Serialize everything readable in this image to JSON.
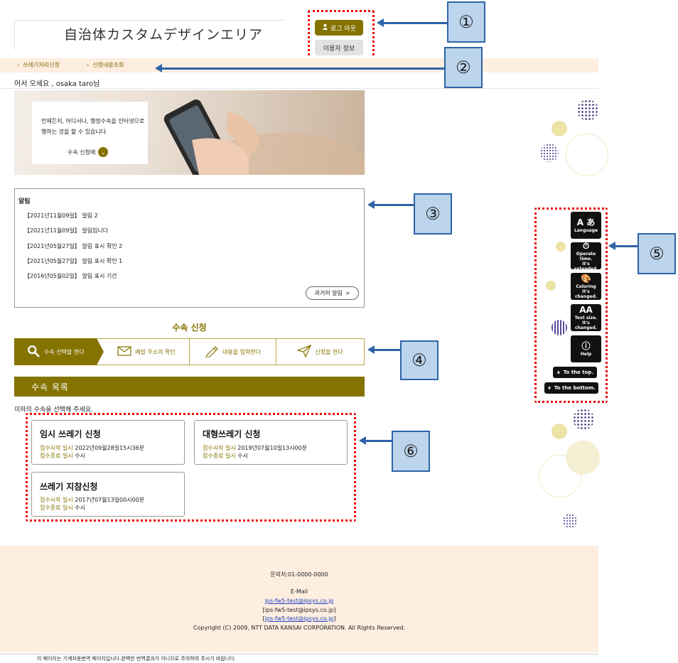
{
  "header": {
    "site_title": "自治体カスタムデザインエリア",
    "logout_label": "로그 아웃",
    "user_info_label": "이용자 정보"
  },
  "nav": {
    "items": [
      {
        "label": "쓰레기처리신청"
      },
      {
        "label": "신청내용조회"
      }
    ]
  },
  "greeting": "어서 오세요 , osaka  taro님",
  "hero": {
    "text": "언제든지, 어디서나, 행정수속을 인터넷으로 행하는 것을 할 수 있습니다",
    "link_label": "수속 신청에"
  },
  "notices": {
    "title": "알림",
    "items": [
      {
        "text": "【2021년11월09일】 알림 2"
      },
      {
        "text": "【2021년11월09일】 알림입니다"
      },
      {
        "text": "【2021년05월27일】 알림 표시 확인 2"
      },
      {
        "text": "【2021년05월27일】 알림 표시 확인 1"
      },
      {
        "text": "【2016년05월02일】 알림 표시 기간"
      }
    ],
    "past_button": "과거의 알림"
  },
  "steps": {
    "title": "수속 신청",
    "items": [
      {
        "label": "수속 선택을 한다"
      },
      {
        "label": "메일 주소의 확인"
      },
      {
        "label": "내용을 입력한다"
      },
      {
        "label": "신청을 한다"
      }
    ]
  },
  "procedures": {
    "header": "수속 목록",
    "hint": "이하의 수속을 선택해 주세요.",
    "start_label": "접수시작 일시",
    "end_label": "접수종료 일시",
    "items": [
      {
        "title": "임시 쓰레기 신청",
        "start": "2022년09월28일15시36분",
        "end": "수시"
      },
      {
        "title": "대형쓰레기 신청",
        "start": "2019년07월10일13시00분",
        "end": "수시"
      },
      {
        "title": "쓰레기 지참신청",
        "start": "2017년07월13일00시00분",
        "end": "수시"
      }
    ]
  },
  "footer": {
    "contact": "문의처:01-0000-0000",
    "email_label": "E-Mail",
    "email_1": "ips-fw5-test@ipsys.co.jp",
    "email_2": "[ips-fw5-test@ipsys.co.jp]",
    "email_3_open": "[",
    "email_3": "ips-fw5-test@ipsys.co.jp",
    "email_3_close": "]",
    "copyright": "Copyright (C) 2009, NTT DATA KANSAI CORPORATION. All Rights Reserved.",
    "machine_translation_note": "이 페이지는 기계자동번역 페이지입니다.완벽한 번역결과가 아니므로 주의하여 주시기 바랍니다."
  },
  "toolbar": {
    "language": "Language",
    "operate_time_1": "Operate time.",
    "operate_time_2": "It's extended.",
    "coloring_1": "Coloring",
    "coloring_2": "It's changed.",
    "text_size_1": "Text size.",
    "text_size_2": "It's changed.",
    "help": "Help",
    "to_top": "To the top.",
    "to_bottom": "To the bottom."
  },
  "callouts": {
    "c1": "①",
    "c2": "②",
    "c3": "③",
    "c4": "④",
    "c5": "⑤",
    "c6": "⑥"
  },
  "colors": {
    "accent": "#857300",
    "nav_bg": "#fdeee0",
    "callout_fill": "#bcd4ec",
    "callout_border": "#2e64a8",
    "highlight_dotted": "#ee0000"
  }
}
